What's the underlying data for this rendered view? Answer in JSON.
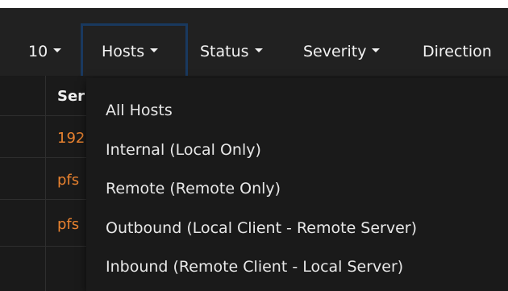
{
  "toolbar": {
    "items": [
      {
        "label": "10"
      },
      {
        "label": "Hosts"
      },
      {
        "label": "Status"
      },
      {
        "label": "Severity"
      },
      {
        "label": "Direction"
      }
    ]
  },
  "table": {
    "header": "Ser",
    "rows": [
      {
        "value": "192",
        "color": "#e9822f"
      },
      {
        "value": "pfs",
        "color": "#e9822f"
      },
      {
        "value": "pfs",
        "color": "#e9822f"
      }
    ]
  },
  "hosts_menu": {
    "items": [
      {
        "label": "All Hosts"
      },
      {
        "label": "Internal (Local Only)"
      },
      {
        "label": "Remote (Remote Only)"
      },
      {
        "label": "Outbound (Local Client - Remote Server)"
      },
      {
        "label": "Inbound (Remote Client - Local Server)"
      }
    ]
  }
}
